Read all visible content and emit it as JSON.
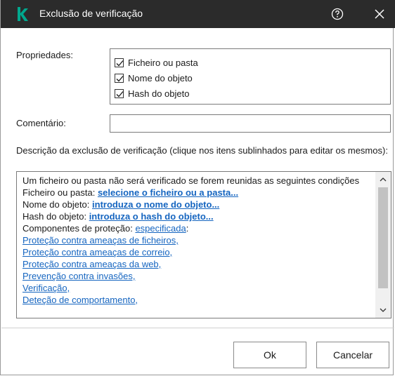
{
  "window": {
    "title": "Exclusão de verificação"
  },
  "form": {
    "properties_label": "Propriedades:",
    "properties": [
      {
        "label": "Ficheiro ou pasta",
        "checked": true
      },
      {
        "label": "Nome do objeto",
        "checked": true
      },
      {
        "label": "Hash do objeto",
        "checked": true
      }
    ],
    "comment_label": "Comentário:",
    "comment_value": ""
  },
  "description": {
    "caption": "Descrição da exclusão de verificação (clique nos itens sublinhados para editar os mesmos):",
    "intro": "Um ficheiro ou pasta não será verificado se forem reunidas as seguintes condições",
    "file_prefix": "Ficheiro ou pasta: ",
    "file_link": "selecione o ficheiro ou a pasta...",
    "name_prefix": "Nome do objeto: ",
    "name_link": "introduza o nome do objeto...",
    "hash_prefix": "Hash do objeto: ",
    "hash_link": "introduza o hash do objeto...",
    "components_prefix": "Componentes de proteção: ",
    "components_link": "especificada",
    "components_suffix": ":",
    "components": [
      "Proteção contra ameaças de ficheiros,",
      "Proteção contra ameaças de correio,",
      "Proteção contra ameaças da web,",
      "Prevenção contra invasões,",
      "Verificação,",
      "Deteção de comportamento,"
    ]
  },
  "buttons": {
    "ok": "Ok",
    "cancel": "Cancelar"
  },
  "colors": {
    "titlebar": "#2b2b2b",
    "logo": "#00a88e",
    "link": "#1565c0"
  },
  "icons": {
    "logo": "kaspersky-logo",
    "help": "help-circle-icon",
    "close": "close-icon"
  }
}
